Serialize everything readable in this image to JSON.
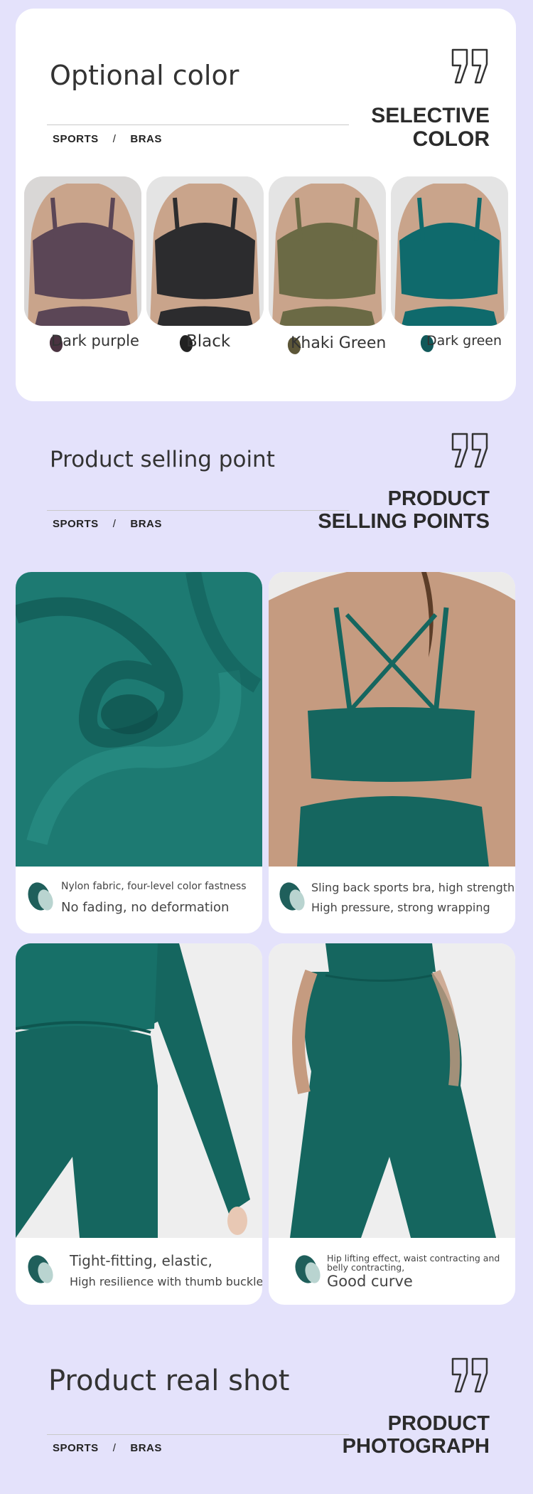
{
  "section_color": {
    "title": "Optional color",
    "crumb": [
      "SPORTS",
      "/",
      "BRAS"
    ],
    "big_line1": "SELECTIVE",
    "big_line2": "COLOR",
    "swatches": [
      {
        "label": "Dark purple",
        "color": "#5b4656",
        "dot": "#4a3340"
      },
      {
        "label": "Black",
        "color": "#2c2c2e",
        "dot": "#222222"
      },
      {
        "label": "Khaki Green",
        "color": "#6b6a45",
        "dot": "#5c5638"
      },
      {
        "label": "Dark green",
        "color": "#0f6a6c",
        "dot": "#11595a"
      }
    ]
  },
  "section_selling": {
    "title": "Product selling point",
    "crumb": [
      "SPORTS",
      "/",
      "BRAS"
    ],
    "big_line1": "PRODUCT",
    "big_line2": "SELLING POINTS",
    "features": [
      {
        "line1": "Nylon fabric, four-level color fastness",
        "line2": "No fading, no deformation",
        "icon": "leaf-icon"
      },
      {
        "line1": "Sling back sports bra, high strength",
        "line2": "High pressure, strong wrapping",
        "icon": "leaf-icon"
      },
      {
        "line1": "Tight-fitting, elastic,",
        "line2": "High resilience with thumb buckle",
        "icon": "leaf-icon"
      },
      {
        "line1": "Hip lifting effect, waist contracting and belly contracting,",
        "line2": "Good curve",
        "icon": "leaf-icon"
      }
    ]
  },
  "section_shot": {
    "title": "Product real shot",
    "crumb": [
      "SPORTS",
      "/",
      "BRAS"
    ],
    "big_line1": "PRODUCT",
    "big_line2": "PHOTOGRAPH"
  },
  "colors": {
    "background": "#e4e2fb",
    "teal": "#15665f",
    "accent_dark": "#1f5f5b"
  }
}
